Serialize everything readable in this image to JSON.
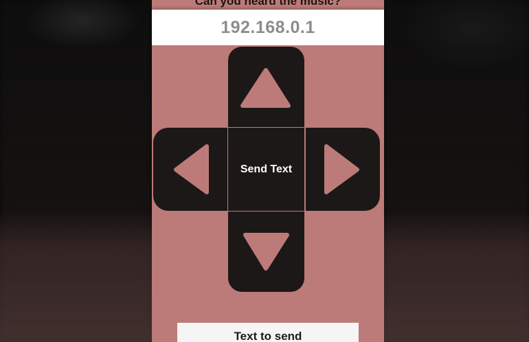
{
  "header": {
    "question": "Can you heard the music?"
  },
  "connection": {
    "ip_address": "192.168.0.1"
  },
  "dpad": {
    "center_label": "Send Text",
    "up_icon": "triangle-up",
    "down_icon": "triangle-down",
    "left_icon": "triangle-left",
    "right_icon": "triangle-right"
  },
  "input": {
    "placeholder": "Text to send",
    "value": ""
  },
  "colors": {
    "background_app": "#bc7b78",
    "pad": "#1c1818",
    "ip_text": "#8c8c8c",
    "field_bg": "#f6f4f4"
  }
}
